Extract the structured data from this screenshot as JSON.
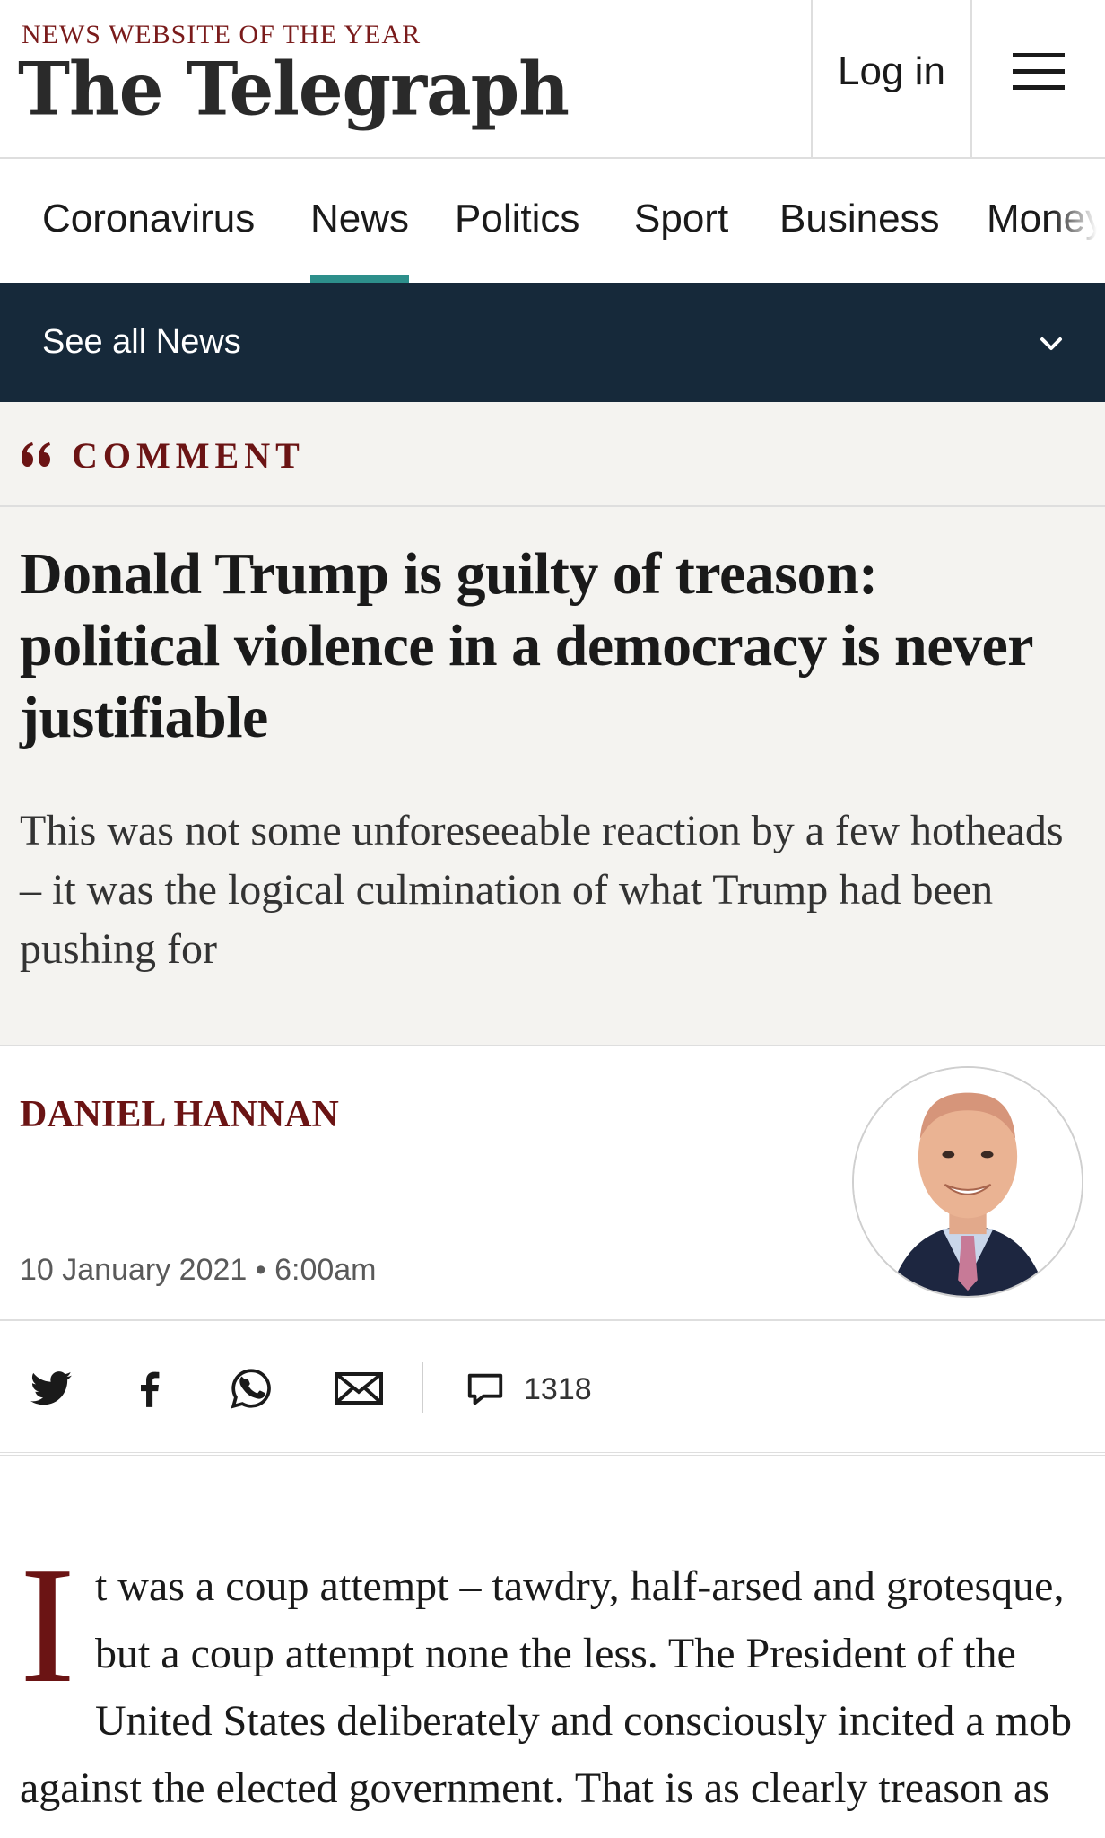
{
  "header": {
    "strapline": "NEWS WEBSITE OF THE YEAR",
    "logo": "The Telegraph",
    "login_label": "Log in",
    "menu_icon": "hamburger-menu-icon"
  },
  "primary_nav": {
    "items": [
      {
        "label": "Coronavirus",
        "active": false
      },
      {
        "label": "News",
        "active": true
      },
      {
        "label": "Politics",
        "active": false
      },
      {
        "label": "Sport",
        "active": false
      },
      {
        "label": "Business",
        "active": false
      },
      {
        "label": "Money",
        "active": false
      }
    ],
    "active_color": "#2d8f8b"
  },
  "sub_nav": {
    "label": "See all News",
    "icon": "chevron-down-icon",
    "background": "#16293a"
  },
  "article": {
    "section_icon": "quote-icon",
    "section_label": "COMMENT",
    "section_color": "#6b1414",
    "headline": "Donald Trump is guilty of treason: political violence in a democracy is never justifiable",
    "standfirst": "This was not some unforeseeable reaction by a few hotheads – it was the logical culmination of what Trump had been pushing for",
    "author": "DANIEL HANNAN",
    "timestamp": "10 January 2021 • 6:00am",
    "body_dropcap": "I",
    "body_text": "t was a coup attempt – tawdry, half-arsed and grotesque, but a coup attempt none the less. The President of the United States deliberately and consciously incited a mob against the elected government. That is as clearly treason as"
  },
  "share_bar": {
    "icons": [
      "twitter-icon",
      "facebook-icon",
      "whatsapp-icon",
      "email-icon"
    ],
    "comment_icon": "comment-icon",
    "comment_count": "1318"
  }
}
